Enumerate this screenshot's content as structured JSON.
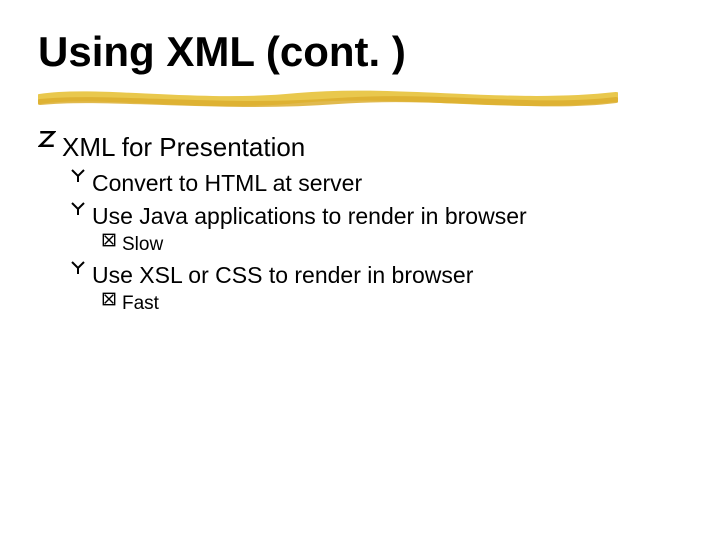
{
  "title": "Using XML (cont. )",
  "bullets": {
    "l1_0": "XML for Presentation",
    "l2_0": "Convert to HTML at server",
    "l2_1": "Use Java applications to render in browser",
    "l3_0": "Slow",
    "l2_2": "Use XSL or CSS to render in browser",
    "l3_1": "Fast"
  }
}
